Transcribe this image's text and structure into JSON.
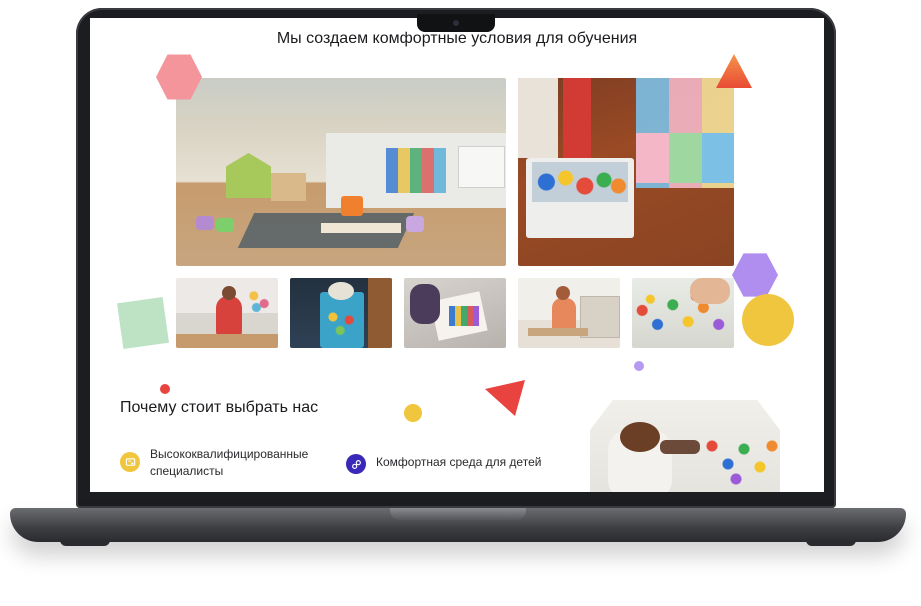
{
  "hero": {
    "title": "Мы создаем комфортные условия для обучения"
  },
  "gallery": {
    "main_photos": [
      {
        "name": "classroom-photo"
      },
      {
        "name": "playroom-photo"
      }
    ],
    "thumbnails": [
      {
        "name": "child-with-toy-photo"
      },
      {
        "name": "educational-toy-photo"
      },
      {
        "name": "drawing-photo"
      },
      {
        "name": "child-at-table-photo"
      },
      {
        "name": "building-blocks-photo"
      }
    ]
  },
  "why_us": {
    "heading": "Почему стоит выбрать нас",
    "features": [
      {
        "label": "Высококвалифицированные специалисты",
        "icon": "certificate-icon",
        "icon_color": "#f1c63f"
      },
      {
        "label": "Комфортная среда для детей",
        "icon": "link-icon",
        "icon_color": "#3a29b8"
      }
    ]
  },
  "colors": {
    "pink": "#f4959b",
    "orange": "#f6934a",
    "purple": "#b08ef0",
    "yellow": "#f1c63f",
    "green": "#bde3c4",
    "red": "#e9433f",
    "indigo": "#3a29b8"
  }
}
